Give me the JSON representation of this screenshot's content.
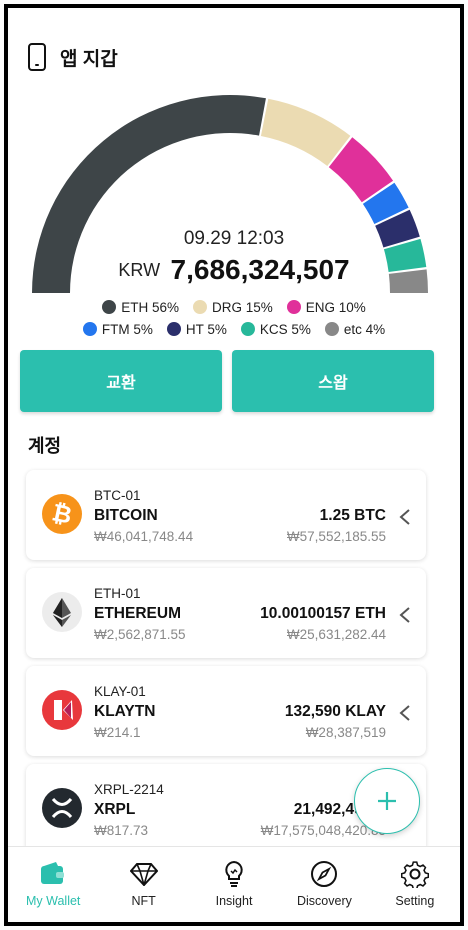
{
  "header": {
    "title": "앱 지갑",
    "icon": "phone-icon"
  },
  "portfolio": {
    "date": "09.29 12:03",
    "currency": "KRW",
    "total": "7,686,324,507"
  },
  "chart_data": {
    "type": "pie",
    "categories": [
      "ETH",
      "DRG",
      "ENG",
      "FTM",
      "HT",
      "KCS",
      "etc"
    ],
    "values": [
      56,
      15,
      10,
      5,
      5,
      5,
      4
    ],
    "colors": [
      "#3e4548",
      "#ebdbb2",
      "#e0309a",
      "#2376ee",
      "#2b2f6b",
      "#27b89a",
      "#888888"
    ]
  },
  "legend": {
    "row1": [
      {
        "label": "ETH 56%",
        "color": "#3e4548"
      },
      {
        "label": "DRG 15%",
        "color": "#ebdbb2"
      },
      {
        "label": "ENG 10%",
        "color": "#e0309a"
      }
    ],
    "row2": [
      {
        "label": "FTM 5%",
        "color": "#2376ee"
      },
      {
        "label": "HT 5%",
        "color": "#2b2f6b"
      },
      {
        "label": "KCS 5%",
        "color": "#27b89a"
      },
      {
        "label": "etc 4%",
        "color": "#888888"
      }
    ]
  },
  "actions": {
    "exchange_label": "교환",
    "swap_label": "스왑"
  },
  "accounts": {
    "title": "계정",
    "items": [
      {
        "id": "BTC-01",
        "name": "BITCOIN",
        "price": "₩46,041,748.44",
        "amount": "1.25 BTC",
        "value": "₩57,552,185.55",
        "icon": "bitcoin-icon"
      },
      {
        "id": "ETH-01",
        "name": "ETHEREUM",
        "price": "₩2,562,871.55",
        "amount": "10.00100157 ETH",
        "value": "₩25,631,282.44",
        "icon": "ethereum-icon"
      },
      {
        "id": "KLAY-01",
        "name": "KLAYTN",
        "price": "₩214.1",
        "amount": "132,590 KLAY",
        "value": "₩28,387,519",
        "icon": "klaytn-icon"
      },
      {
        "id": "XRPL-2214",
        "name": "XRPL",
        "price": "₩817.73",
        "amount": "21,492,490 X",
        "value": "₩17,575,048,420.85",
        "icon": "xrp-icon"
      }
    ]
  },
  "fab": {
    "icon": "plus-icon"
  },
  "nav": {
    "items": [
      {
        "label": "My Wallet",
        "icon": "wallet-icon",
        "active": true
      },
      {
        "label": "NFT",
        "icon": "diamond-icon",
        "active": false
      },
      {
        "label": "Insight",
        "icon": "lightbulb-icon",
        "active": false
      },
      {
        "label": "Discovery",
        "icon": "compass-icon",
        "active": false
      },
      {
        "label": "Setting",
        "icon": "gear-icon",
        "active": false
      }
    ]
  },
  "colors": {
    "accent": "#2bbfae",
    "text": "#111111",
    "muted": "#888888"
  }
}
